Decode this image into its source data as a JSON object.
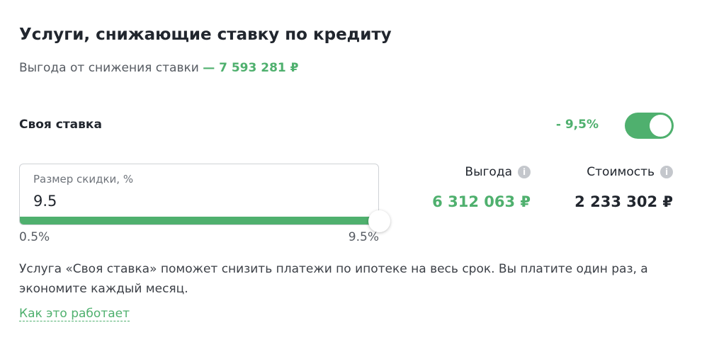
{
  "header": {
    "title": "Услуги, снижающие ставку по кредиту",
    "benefit_prefix": "Выгода от снижения ставки",
    "benefit_value": "— 7 593 281 ₽"
  },
  "option": {
    "label": "Своя ставка",
    "discount": "- 9,5%",
    "toggle_on": true
  },
  "discount_field": {
    "label": "Размер скидки, %",
    "value": "9.5",
    "range_min": "0.5%",
    "range_max": "9.5%",
    "slider_fraction": 1.0
  },
  "stats": {
    "benefit_label": "Выгода",
    "benefit_value": "6 312 063 ₽",
    "cost_label": "Стоимость",
    "cost_value": "2 233 302 ₽",
    "info_glyph": "i"
  },
  "description": "Услуга «Своя ставка» поможет снизить платежи по ипотеке на весь срок. Вы платите один раз, а экономите каждый месяц.",
  "link_label": "Как это работает",
  "colors": {
    "accent": "#4fb06e",
    "text": "#21262e",
    "muted": "#565b62",
    "icon_gray": "#c4c7cc"
  }
}
